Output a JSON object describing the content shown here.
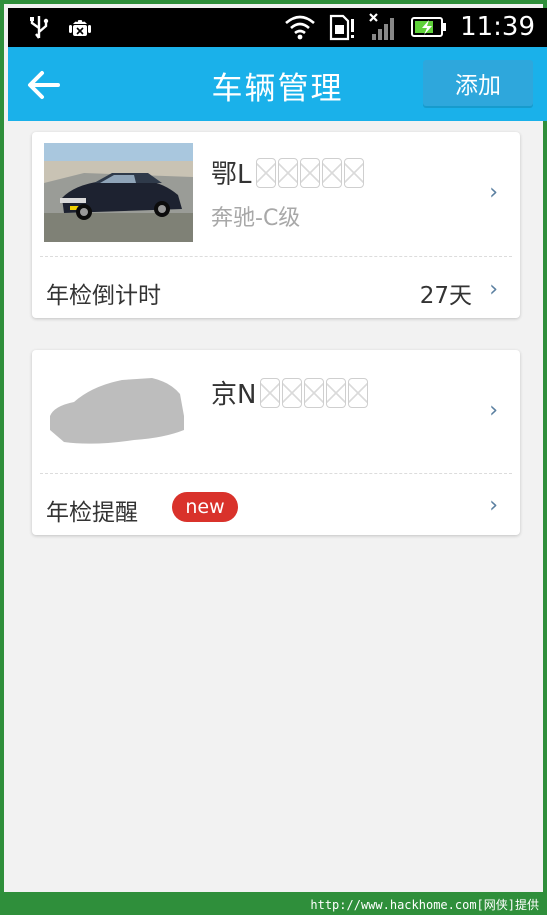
{
  "status_bar": {
    "time": "11:39",
    "icons": [
      "usb-icon",
      "android-debug-icon",
      "wifi-icon",
      "sim-icon",
      "signal-icon",
      "battery-charging-icon"
    ]
  },
  "header": {
    "title": "车辆管理",
    "add_label": "添加",
    "color": "#1ab1ea"
  },
  "cars": [
    {
      "plate_prefix": "鄂L",
      "model": "奔驰-C级",
      "row_label": "年检倒计时",
      "row_value": "27天"
    },
    {
      "plate_prefix": "京N",
      "row_label": "年检提醒",
      "badge": "new"
    }
  ],
  "watermark": "http://www.hackhome.com[网侠]提供"
}
